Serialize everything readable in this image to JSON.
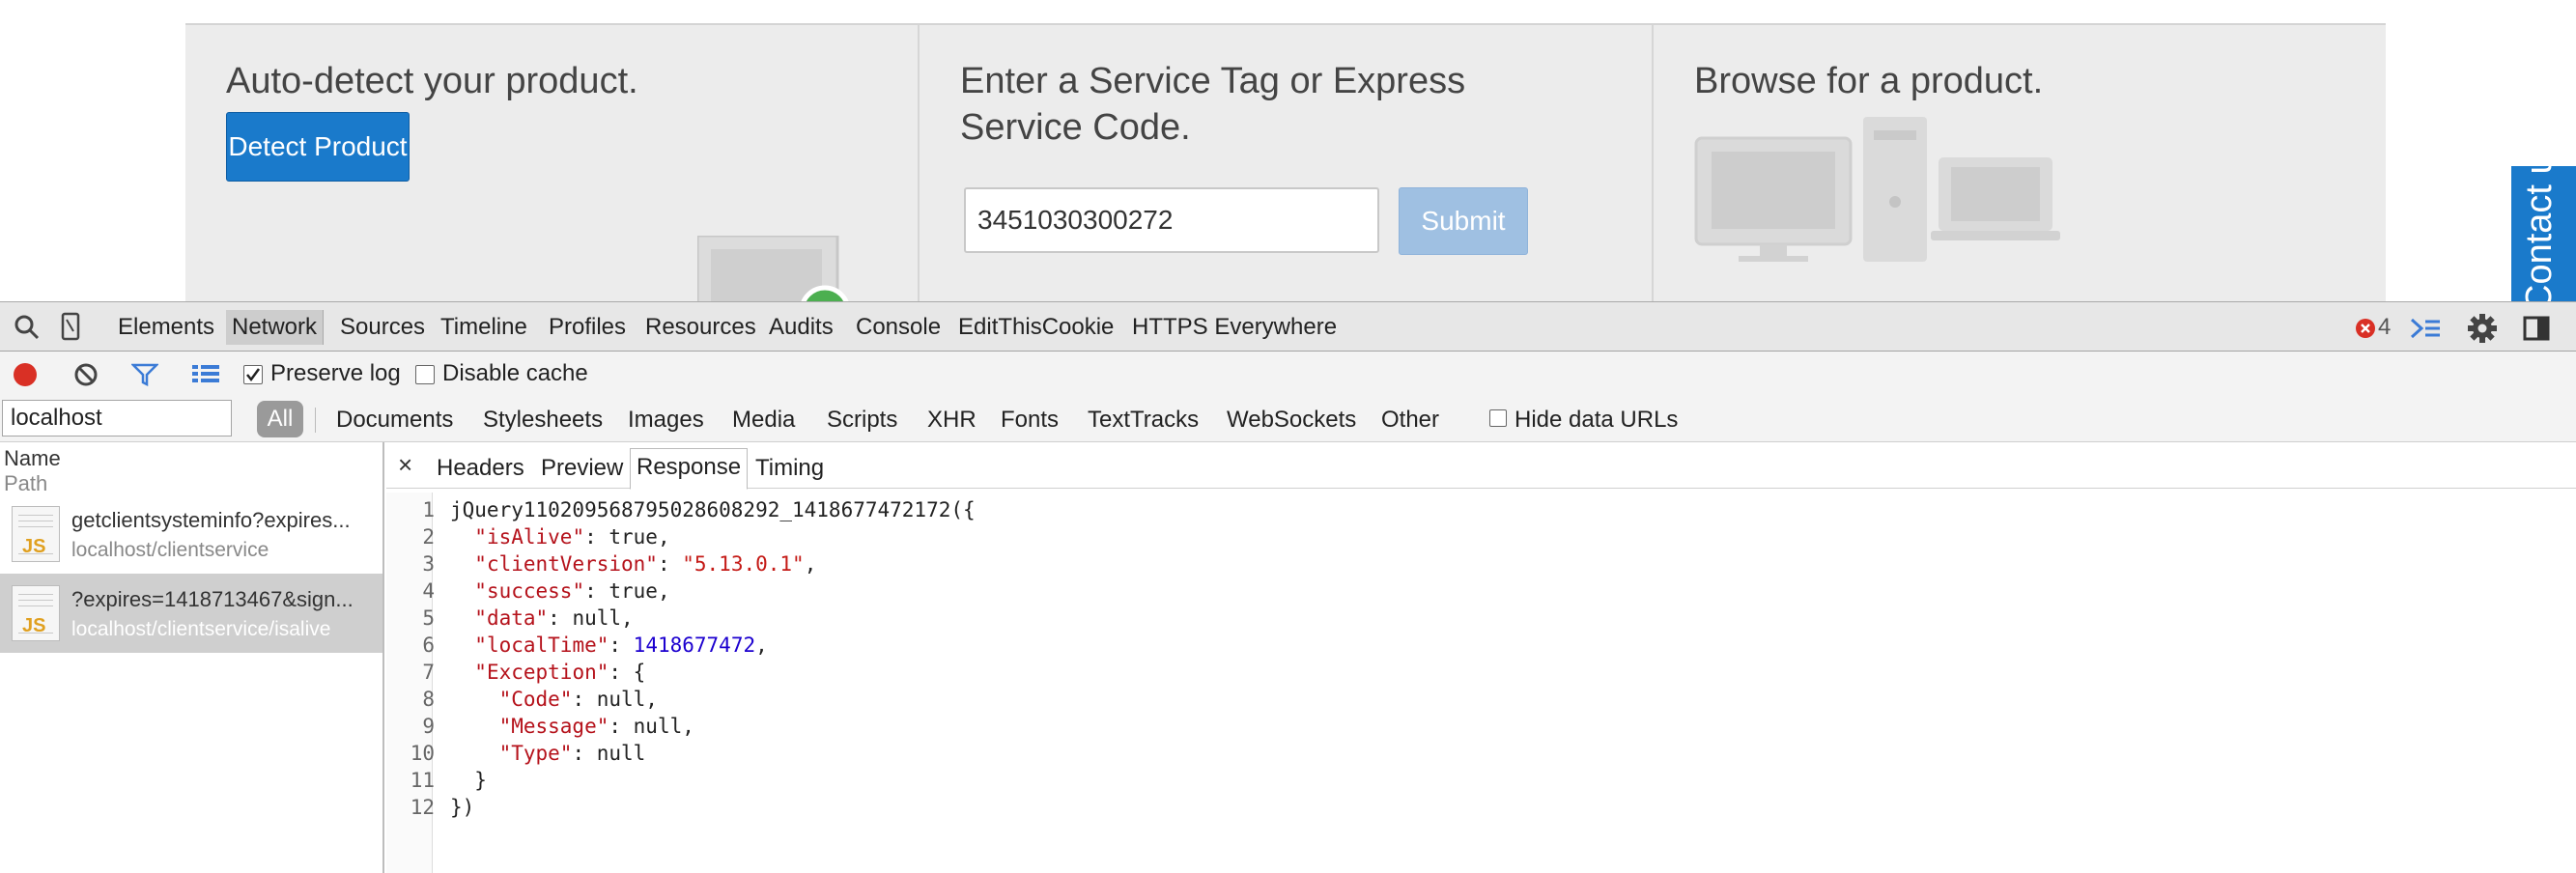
{
  "page": {
    "autodetect_title": "Auto-detect your product.",
    "detect_button": "Detect Product",
    "service_tag_title": "Enter a Service Tag or Express Service Code.",
    "service_tag_value": "3451030300272",
    "submit_button": "Submit",
    "browse_title": "Browse for a product.",
    "contact_tab": "Contact us"
  },
  "devtools": {
    "tabs": [
      "Elements",
      "Network",
      "Sources",
      "Timeline",
      "Profiles",
      "Resources",
      "Audits",
      "Console",
      "EditThisCookie",
      "HTTPS Everywhere"
    ],
    "active_tab": "Network",
    "error_count": "4",
    "toolbar": {
      "preserve_log": "Preserve log",
      "preserve_log_checked": true,
      "disable_cache": "Disable cache",
      "disable_cache_checked": false
    },
    "filter": {
      "value": "localhost",
      "all": "All",
      "types": [
        "Documents",
        "Stylesheets",
        "Images",
        "Media",
        "Scripts",
        "XHR",
        "Fonts",
        "TextTracks",
        "WebSockets",
        "Other"
      ],
      "hide_data_urls": "Hide data URLs"
    },
    "columns": {
      "name": "Name",
      "path": "Path"
    },
    "requests": [
      {
        "name": "getclientsysteminfo?expires...",
        "path": "localhost/clientservice",
        "icon": "JS",
        "selected": false
      },
      {
        "name": "?expires=1418713467&sign...",
        "path": "localhost/clientservice/isalive",
        "icon": "JS",
        "selected": true
      }
    ],
    "detail_tabs": [
      "Headers",
      "Preview",
      "Response",
      "Timing"
    ],
    "active_detail_tab": "Response",
    "response_lines": [
      "jQuery110209568795028608292_1418677472172({",
      "  \"isAlive\": true,",
      "  \"clientVersion\": \"5.13.0.1\",",
      "  \"success\": true,",
      "  \"data\": null,",
      "  \"localTime\": 1418677472,",
      "  \"Exception\": {",
      "    \"Code\": null,",
      "    \"Message\": null,",
      "    \"Type\": null",
      "  }",
      "})"
    ]
  },
  "colors": {
    "accent_blue": "#1a7acb",
    "record_red": "#d93025",
    "json_key": "#b5121b",
    "json_string": "#c41a16",
    "json_number": "#1c00cf"
  }
}
